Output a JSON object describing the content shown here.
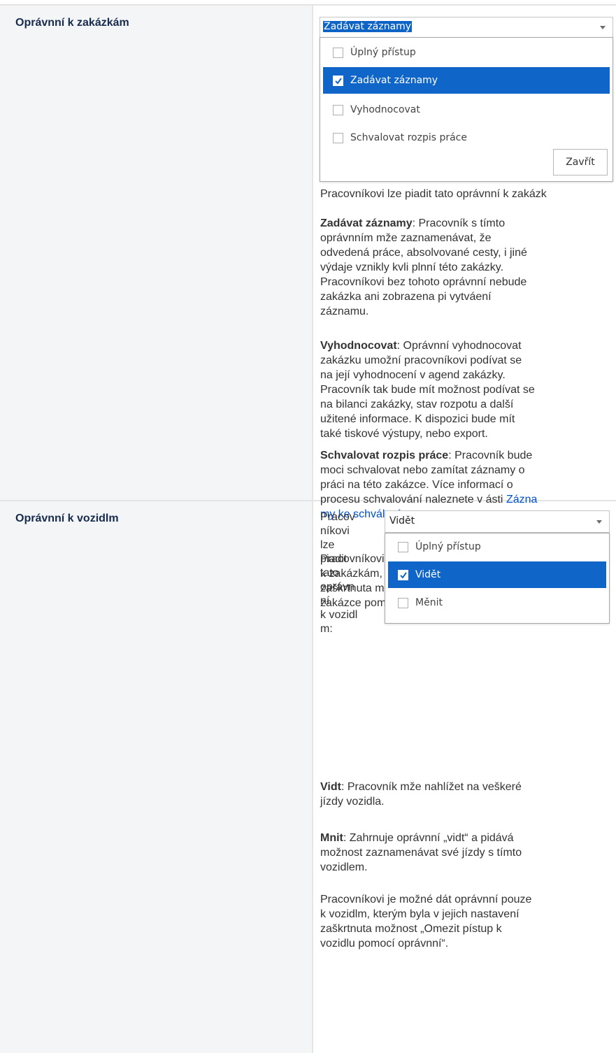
{
  "rows": [
    {
      "header": "Oprávnní k zakázkám",
      "dropdown": {
        "selected_value": "Zadávat záznamy",
        "options": [
          {
            "label": "Úplný přístup",
            "checked": false
          },
          {
            "label": "Zadávat záznamy",
            "checked": true
          },
          {
            "label": "Vyhodnocovat",
            "checked": false
          },
          {
            "label": "Schvalovat rozpis práce",
            "checked": false
          }
        ],
        "close_label": "Zavřít"
      },
      "intro": "Pracovníkovi lze piadit tato oprávnní k zakázk",
      "paragraphs": [
        {
          "term": "Zadávat záznamy",
          "lines": [
            ": Pracovník s tímto",
            "oprávnním mže zaznamenávat, že",
            "odvedená práce, absolvované cesty, i jiné",
            "výdaje vznikly kvli plnní této zakázky.",
            "Pracovníkovi bez tohoto oprávnní nebude",
            "zakázka ani zobrazena pi vytváení",
            "záznamu."
          ]
        },
        {
          "term": "Vyhodnocovat",
          "lines": [
            ": Oprávnní vyhodnocovat",
            "zakázku umožní pracovníkovi podívat se",
            "na její vyhodnocení v agend zakázky.",
            "Pracovník tak bude mít možnost podívat se",
            "na bilanci zakázky, stav rozpotu a další",
            "užitené informace. K dispozici bude mít",
            "také tiskové výstupy, nebo export."
          ]
        },
        {
          "term": "Schvalovat rozpis práce",
          "lines": [
            ": Pracovník bude",
            "moci schvalovat nebo zamítat záznamy o",
            "práci na této zakázce. Více informací o",
            "procesu schvalování naleznete v ásti "
          ],
          "link_part1": "Zázna",
          "link_part2": "my ke schválení",
          "link_tail": "."
        }
      ],
      "footer_lines": [
        "Pracovníkovi je možné dát oprávnní pouze",
        "k zakázkám, kterým byla v jejich nastavení",
        "zaškrtnuta možnost „Omezit pístup k",
        "zakázce pomocí oprávnní“."
      ]
    },
    {
      "header": "Oprávnní k vozidlm",
      "narrow_text_lines": [
        "Pracov",
        "níkovi",
        "lze",
        "piadit",
        "tato",
        "oprávn",
        "ní",
        "k vozidl",
        "m:"
      ],
      "dropdown": {
        "selected_value": "Vidět",
        "options": [
          {
            "label": "Úplný přístup",
            "checked": false
          },
          {
            "label": "Vidět",
            "checked": true
          },
          {
            "label": "Měnit",
            "checked": false
          }
        ]
      },
      "paragraphs": [
        {
          "term": "Vidt",
          "lines": [
            ": Pracovník mže nahlížet na veškeré",
            "jízdy vozidla."
          ]
        },
        {
          "term": "Mnit",
          "lines": [
            ": Zahrnuje oprávnní „vidt“ a pidává",
            "možnost zaznamenávat své jízdy s tímto",
            "vozidlem."
          ]
        }
      ],
      "footer_lines": [
        "Pracovníkovi je možné dát oprávnní pouze",
        "k vozidlm, kterým byla v jejich nastavení",
        "zaškrtnuta možnost „Omezit pístup k",
        "vozidlu pomocí oprávnní“."
      ]
    }
  ]
}
